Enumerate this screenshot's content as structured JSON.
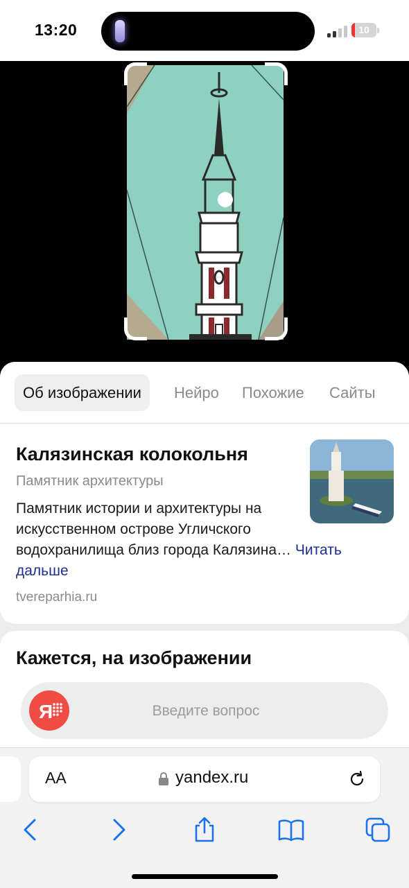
{
  "status_bar": {
    "time": "13:20",
    "battery": "10"
  },
  "tabs": [
    {
      "label": "Об изображении",
      "active": true
    },
    {
      "label": "Нейро",
      "active": false
    },
    {
      "label": "Похожие",
      "active": false
    },
    {
      "label": "Сайты",
      "active": false
    }
  ],
  "result": {
    "title": "Калязинская колокольня",
    "subtitle": "Памятник архитектуры",
    "description": "Памятник истории и архитектуры на искусственном острове Угличского водохранилища близ города Калязина…",
    "read_more": "Читать дальше",
    "source": "tvereparhia.ru"
  },
  "question": {
    "title": "Кажется, на изображении",
    "placeholder": "Введите вопрос"
  },
  "browser": {
    "text_size_label": "AA",
    "url": "yandex.ru"
  },
  "colors": {
    "accent": "#1d2e8f",
    "brand": "#f04c43"
  }
}
